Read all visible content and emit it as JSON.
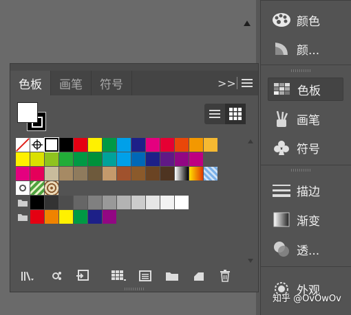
{
  "workspace": {
    "scroll_up_icon": "triangle-up-icon"
  },
  "dock": {
    "items": [
      {
        "label": "颜色",
        "icon": "color-palette-icon",
        "active": false
      },
      {
        "label": "颜...",
        "icon": "color-guide-icon",
        "active": false
      },
      {
        "label": "色板",
        "icon": "swatches-grid-icon",
        "active": true
      },
      {
        "label": "画笔",
        "icon": "brushes-icon",
        "active": false
      },
      {
        "label": "符号",
        "icon": "symbols-club-icon",
        "active": false
      },
      {
        "label": "描边",
        "icon": "stroke-lines-icon",
        "active": false
      },
      {
        "label": "渐变",
        "icon": "gradient-icon",
        "active": false
      },
      {
        "label": "透...",
        "icon": "transparency-icon",
        "active": false
      },
      {
        "label": "外观",
        "icon": "appearance-icon",
        "active": false
      }
    ]
  },
  "panel": {
    "tabs": [
      {
        "label": "色板",
        "active": true
      },
      {
        "label": "画笔",
        "active": false
      },
      {
        "label": "符号",
        "active": false
      }
    ],
    "expand_label": ">>",
    "menu_icon": "hamburger-menu-icon",
    "view_toggle": {
      "list_icon": "list-view-icon",
      "grid_icon": "grid-view-icon",
      "selected": "grid"
    },
    "swatch_rows": [
      [
        "none",
        "reg",
        "white-sel",
        "#000000",
        "#e50012",
        "#fff100",
        "#009944",
        "#00a0e9",
        "#1d2088",
        "#e4007f",
        "#e60033",
        "#e94709",
        "#f39800",
        "#f5b932"
      ],
      [
        "#fff000",
        "#dbe000",
        "#8fc31f",
        "#22ac38",
        "#009944",
        "#00913a",
        "#00a29a",
        "#00a0e9",
        "#0068b7",
        "#1d2088",
        "#601986",
        "#920783",
        "#be0081"
      ],
      [
        "#e4007f",
        "#e5005a",
        "#c9bc9c",
        "#a68a64",
        "#8f7b5d",
        "#6e5a3c",
        "#c49a6c",
        "#a0522d",
        "#8b5a2b",
        "#6b4423",
        "#4e3421",
        "grad-bw",
        "grad-orange",
        "pattern-blue"
      ],
      [
        "pattern-dots",
        "pattern-leaf",
        "pattern-brown"
      ],
      [
        "folder",
        "#000000",
        "#333333",
        "#4d4d4d",
        "#666666",
        "#808080",
        "#999999",
        "#b3b3b3",
        "#cccccc",
        "#e6e6e6",
        "#f2f2f2",
        "#ffffff"
      ],
      [
        "folder",
        "#e50012",
        "#f08300",
        "#fff100",
        "#009944",
        "#1d2088",
        "#920783"
      ]
    ],
    "bottom_icons": [
      "library-icon",
      "show-swatch-kinds-icon",
      "place-swatch-library-icon",
      "swatch-options-icon",
      "new-color-group-icon",
      "folder-icon",
      "new-swatch-icon",
      "delete-icon"
    ]
  },
  "watermark": "知乎 @OvOwOv"
}
